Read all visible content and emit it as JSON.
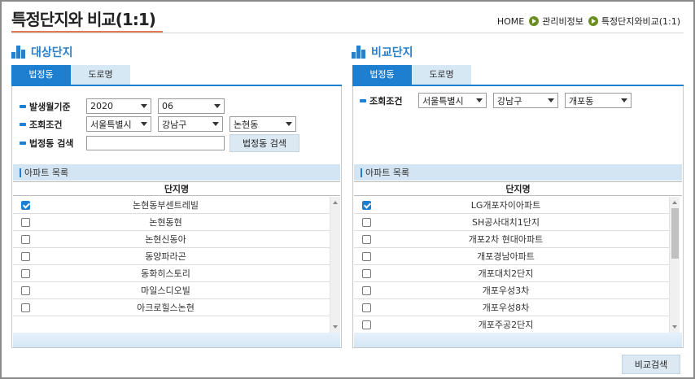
{
  "page": {
    "title": "특정단지와 비교(1:1)",
    "breadcrumb": [
      "HOME",
      "관리비정보",
      "특정단지와비교(1:1)"
    ]
  },
  "left": {
    "heading": "대상단지",
    "tabs": [
      "법정동",
      "도로명"
    ],
    "filters": {
      "period_label": "발생월기준",
      "year": "2020",
      "month": "06",
      "region_label": "조회조건",
      "sido": "서울특별시",
      "gu": "강남구",
      "dong": "논현동",
      "search_label": "법정동 검색",
      "search_value": "",
      "search_button": "법정동 검색"
    },
    "list_title": "아파트 목록",
    "column": "단지명",
    "rows": [
      {
        "name": "논현동부센트레빌",
        "checked": true
      },
      {
        "name": "논현동현",
        "checked": false
      },
      {
        "name": "논현신동아",
        "checked": false
      },
      {
        "name": "동양파라곤",
        "checked": false
      },
      {
        "name": "동화히스토리",
        "checked": false
      },
      {
        "name": "마일스디오빌",
        "checked": false
      },
      {
        "name": "아크로힐스논현",
        "checked": false
      }
    ]
  },
  "right": {
    "heading": "비교단지",
    "tabs": [
      "법정동",
      "도로명"
    ],
    "filters": {
      "region_label": "조회조건",
      "sido": "서울특별시",
      "gu": "강남구",
      "dong": "개포동"
    },
    "list_title": "아파트 목록",
    "column": "단지명",
    "rows": [
      {
        "name": "LG개포자이아파트",
        "checked": true
      },
      {
        "name": "SH공사대치1단지",
        "checked": false
      },
      {
        "name": "개포2차 현대아파트",
        "checked": false
      },
      {
        "name": "개포경남아파트",
        "checked": false
      },
      {
        "name": "개포대치2단지",
        "checked": false
      },
      {
        "name": "개포우성3차",
        "checked": false
      },
      {
        "name": "개포우성8차",
        "checked": false
      },
      {
        "name": "개포주공2단지",
        "checked": false
      }
    ]
  },
  "actions": {
    "compare_button": "비교검색"
  },
  "colors": {
    "accent": "#1e7fd0",
    "title_underline": "#e07b53",
    "breadcrumb_arrow": "#6b8e23"
  }
}
